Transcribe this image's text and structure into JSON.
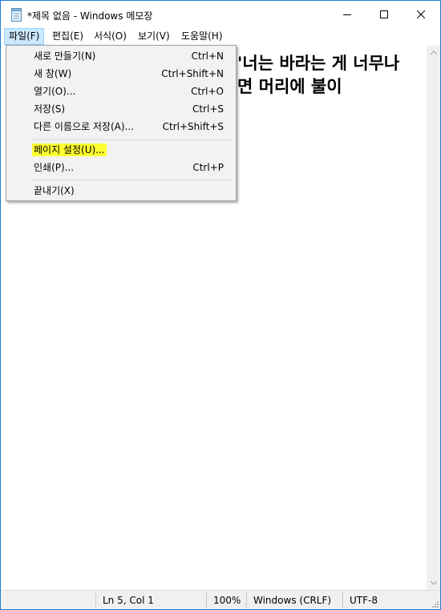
{
  "window": {
    "title": "*제목 없음 - Windows 메모장",
    "accent_color": "#1e7bd6",
    "icons": {
      "app": "notepad-icon",
      "minimize": "minimize-icon",
      "maximize": "maximize-icon",
      "close": "close-icon"
    }
  },
  "menubar": {
    "items": [
      {
        "label": "파일(F)",
        "active": true
      },
      {
        "label": "편집(E)"
      },
      {
        "label": "서식(O)"
      },
      {
        "label": "보기(V)"
      },
      {
        "label": "도움말(H)"
      }
    ]
  },
  "file_menu": {
    "items": [
      {
        "label": "새로 만들기(N)",
        "shortcut": "Ctrl+N"
      },
      {
        "label": "새 창(W)",
        "shortcut": "Ctrl+Shift+N"
      },
      {
        "label": "열기(O)...",
        "shortcut": "Ctrl+O"
      },
      {
        "label": "저장(S)",
        "shortcut": "Ctrl+S"
      },
      {
        "label": "다른 이름으로 저장(A)...",
        "shortcut": "Ctrl+Shift+S"
      },
      {
        "label": "페이지 설정(U)...",
        "shortcut": "",
        "highlighted": true,
        "highlight_color": "#ffff33"
      },
      {
        "label": "인쇄(P)...",
        "shortcut": "Ctrl+P"
      },
      {
        "label": "끝내기(X)",
        "shortcut": ""
      }
    ]
  },
  "editor": {
    "lines": [
      "'너는 바라는 게 너무나",
      "면 머리에 불이"
    ]
  },
  "statusbar": {
    "position": "Ln 5, Col 1",
    "zoom": "100%",
    "line_ending": "Windows (CRLF)",
    "encoding": "UTF-8"
  }
}
